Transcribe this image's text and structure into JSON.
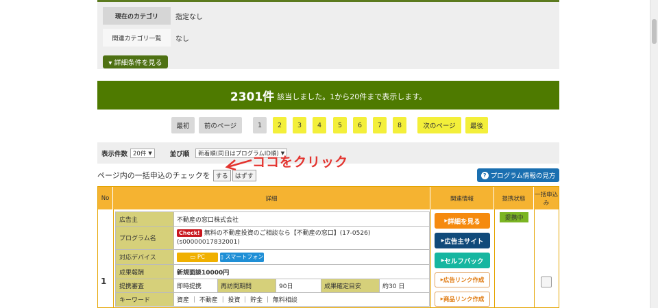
{
  "filter": {
    "current_category_label": "現在のカテゴリ",
    "current_category_value": "指定なし",
    "related_category_label": "関連カテゴリ一覧",
    "related_category_value": "なし",
    "more_button": "▾ 詳細条件を見る"
  },
  "results": {
    "count": "2301件",
    "text": "該当しました。1から20件まで表示します。"
  },
  "pager": {
    "first": "最初",
    "prev": "前のページ",
    "pages": [
      "1",
      "2",
      "3",
      "4",
      "5",
      "6",
      "7",
      "8"
    ],
    "current_page": "1",
    "next": "次のページ",
    "last": "最後"
  },
  "sort": {
    "per_page_label": "表示件数",
    "per_page_value": "20件",
    "order_label": "並び順",
    "order_value": "新着順(同日はプログラムID順)"
  },
  "bulk": {
    "text": "ページ内の一括申込のチェックを",
    "do_button": "する",
    "undo_button": "はずす",
    "annotation": "ココをクリック",
    "how_button": "プログラム情報の見方"
  },
  "table": {
    "headers": {
      "no": "No",
      "detail": "詳細",
      "related": "関連情報",
      "status": "提携状態",
      "bulk": "一括申込み"
    },
    "row": {
      "no": "1",
      "advertiser_label": "広告主",
      "advertiser_value": "不動産の窓口株式会社",
      "program_label": "プログラム名",
      "check_badge": "Check!",
      "program_value": "無料の不動産投資のご相談なら【不動産の窓口】(17-0526)",
      "program_id": "(s00000017832001)",
      "device_label": "対応デバイス",
      "device_pc": "PC",
      "device_sp": "スマートフォン",
      "reward_label": "成果報酬",
      "reward_value": "新規面談10000円",
      "review_label": "提携審査",
      "review_value": "即時提携",
      "revisit_label": "再訪問期間",
      "revisit_value": "90日",
      "confirm_label": "成果確定目安",
      "confirm_value": "約30 日",
      "keyword_label": "キーワード",
      "keyword_value": "資産 ｜ 不動産 ｜ 投資 ｜ 貯金 ｜ 無料相談",
      "status": "提携中",
      "buttons": {
        "detail": "詳細を見る",
        "advertiser_site": "広告主サイト",
        "selfback": "セルフバック",
        "ad_link": "広告リンク作成",
        "product_link": "商品リンク作成"
      }
    }
  },
  "colors": {
    "banner": "#4e7a00",
    "accent_yellow": "#f3ef3a",
    "table_header": "#f5b331",
    "annotation": "#e3342f"
  }
}
